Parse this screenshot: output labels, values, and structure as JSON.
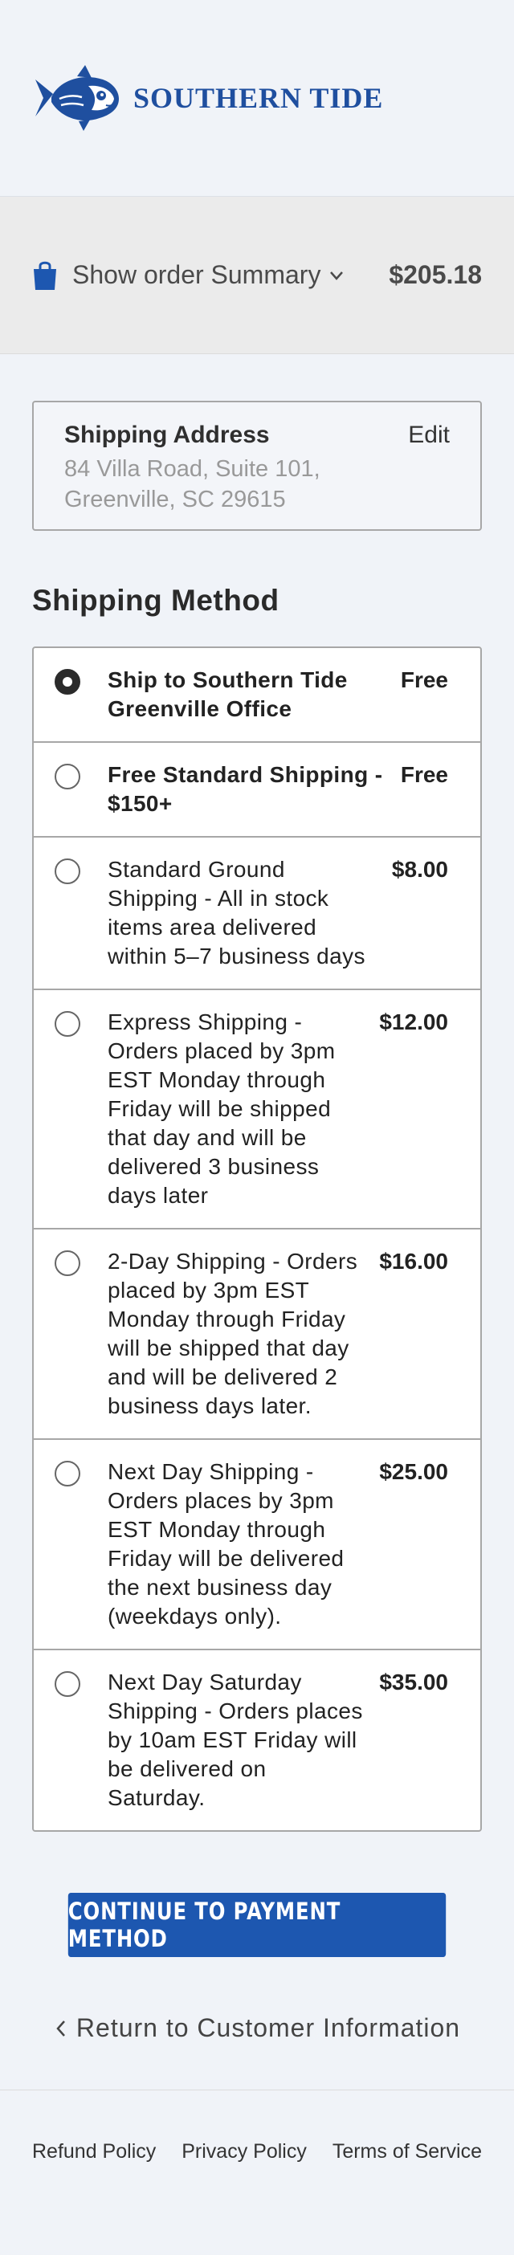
{
  "brand": {
    "name": "SOUTHERN TIDE",
    "color": "#1f4f9f",
    "logo_icon": "skipjack-fish-logo"
  },
  "order_summary": {
    "toggle_label": "Show order Summary",
    "total": "$205.18",
    "icon": "shopping-bag-icon"
  },
  "shipping_address": {
    "title": "Shipping Address",
    "edit_label": "Edit",
    "line1": "84 Villa Road, Suite 101,",
    "line2": "Greenville, SC 29615"
  },
  "shipping_method": {
    "title": "Shipping Method",
    "options": [
      {
        "label": "Ship to Southern Tide Greenville Office",
        "price": "Free",
        "selected": true,
        "bold": true
      },
      {
        "label": "Free Standard Shipping - $150+",
        "price": "Free",
        "selected": false,
        "bold": true
      },
      {
        "label": "Standard Ground Shipping - All in stock items area delivered within 5–7 business days",
        "price": "$8.00",
        "selected": false,
        "bold": false
      },
      {
        "label": "Express Shipping - Orders placed by 3pm EST Monday through Friday will be shipped that day and will be delivered 3 business days later",
        "price": "$12.00",
        "selected": false,
        "bold": false
      },
      {
        "label": "2-Day Shipping - Orders placed by 3pm EST Monday through Friday will be shipped that day and will be delivered 2 business days later.",
        "price": "$16.00",
        "selected": false,
        "bold": false
      },
      {
        "label": "Next Day Shipping - Orders places by 3pm EST Monday through Friday will be delivered the next business day (weekdays only).",
        "price": "$25.00",
        "selected": false,
        "bold": false
      },
      {
        "label": "Next Day Saturday Shipping - Orders places by 10am EST Friday will be delivered on Saturday.",
        "price": "$35.00",
        "selected": false,
        "bold": false
      }
    ]
  },
  "actions": {
    "continue_label": "CONTINUE TO PAYMENT METHOD",
    "continue_color": "#1d57b0",
    "return_label": "Return to Customer Information"
  },
  "footer": {
    "links": [
      "Refund Policy",
      "Privacy Policy",
      "Terms of Service"
    ]
  }
}
